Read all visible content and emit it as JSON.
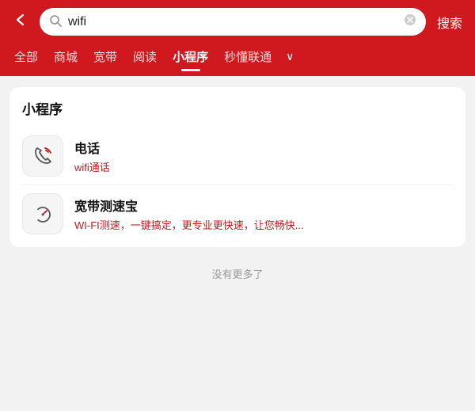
{
  "header": {
    "back_label": "‹",
    "search_value": "wifi",
    "clear_icon": "✕",
    "search_button": "搜索"
  },
  "tabs": [
    {
      "id": "all",
      "label": "全部",
      "active": false
    },
    {
      "id": "mall",
      "label": "商城",
      "active": false
    },
    {
      "id": "broadband",
      "label": "宽带",
      "active": false
    },
    {
      "id": "reading",
      "label": "阅读",
      "active": false
    },
    {
      "id": "miniapp",
      "label": "小程序",
      "active": true
    },
    {
      "id": "quicklearn",
      "label": "秒懂联通",
      "active": false
    }
  ],
  "tab_more": "∨",
  "section": {
    "title": "小程序",
    "items": [
      {
        "id": "phone",
        "icon": "📞",
        "title": "电话",
        "subtitle_prefix": "wifi",
        "subtitle_suffix": "通话"
      },
      {
        "id": "speedtest",
        "icon": "🕐",
        "title": "宽带测速宝",
        "subtitle": "WI-FI测速，一键搞定，更专业更快速，让您畅快..."
      }
    ]
  },
  "no_more_label": "没有更多了",
  "colors": {
    "brand": "#d0191e",
    "active_tab": "#ffffff"
  }
}
